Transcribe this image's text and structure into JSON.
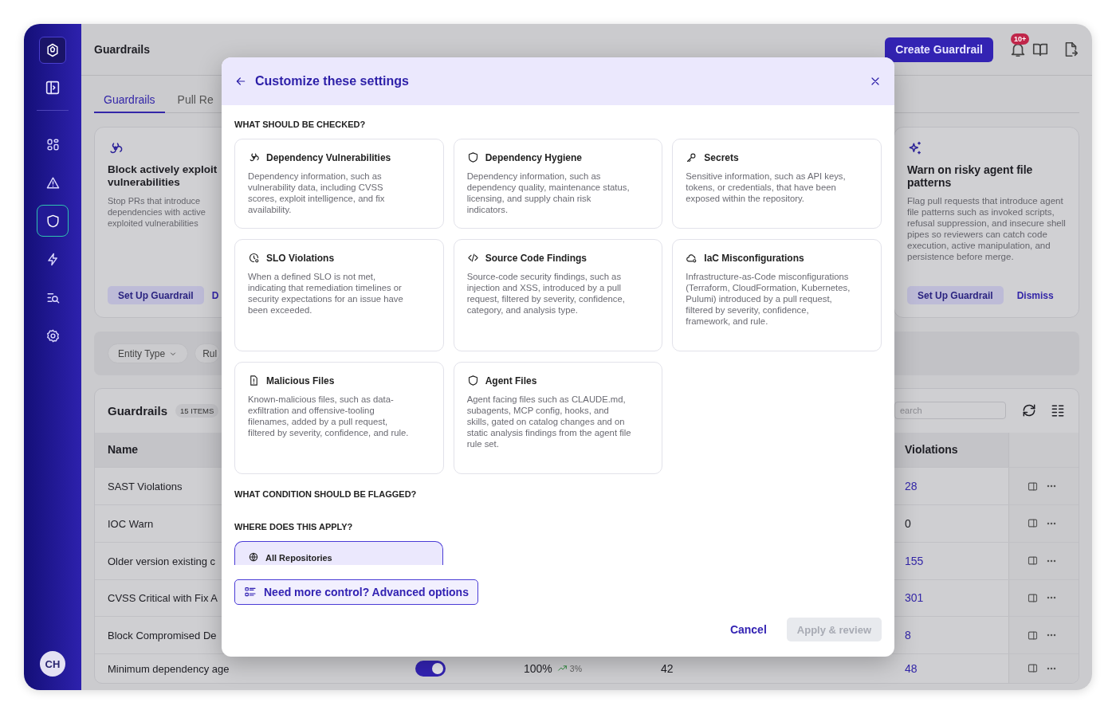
{
  "sidebar": {
    "nav": [
      {
        "selected": false
      },
      {
        "selected": false
      },
      {
        "selected": true
      },
      {
        "selected": false
      },
      {
        "selected": false
      },
      {
        "selected": false
      }
    ],
    "avatar": "CH"
  },
  "header": {
    "title": "Guardrails",
    "create_button": "Create Guardrail",
    "notification_badge": "10+"
  },
  "tabs": [
    {
      "label": "Guardrails",
      "selected": true
    },
    {
      "label": "Pull Re",
      "selected": false
    }
  ],
  "cards": [
    {
      "title": "Block actively exploit\nvulnerabilities",
      "description": "Stop PRs that introduce\ndependencies with active\nexploited vulnerabilities",
      "primary_button": "Set Up Guardrail",
      "secondary_link": "D"
    },
    {
      "title": "Warn on risky agent file patterns",
      "description": "Flag pull requests that introduce agent file patterns such as invoked scripts, refusal suppression, and insecure shell pipes so reviewers can catch code execution, active manipulation, and persistence before merge.",
      "primary_button": "Set Up Guardrail",
      "secondary_link": "Dismiss"
    }
  ],
  "filters": [
    {
      "label": "Entity Type",
      "kind": "dropdown"
    },
    {
      "label": "Rul",
      "kind": "chip"
    }
  ],
  "table": {
    "title": "Guardrails",
    "count": "15 ITEMS",
    "search_placeholder": "earch",
    "columns": [
      "Name",
      "Violations"
    ],
    "rows": [
      {
        "name": "SAST Violations",
        "violations": "28",
        "linked": true
      },
      {
        "name": "IOC Warn",
        "violations": "0",
        "linked": false
      },
      {
        "name": "Older version existing c",
        "violations": "155",
        "linked": true
      },
      {
        "name": "CVSS Critical with Fix A",
        "violations": "301",
        "linked": true
      },
      {
        "name": "Block Compromised De",
        "violations": "8",
        "linked": true
      },
      {
        "name": "Minimum dependency age",
        "violations": "48",
        "linked": true,
        "enabled": true,
        "pass_rate": "100%",
        "trend": "3%",
        "count": "42"
      }
    ]
  },
  "modal": {
    "title": "Customize these settings",
    "checks_heading": "WHAT SHOULD BE CHECKED?",
    "checks": [
      {
        "title": "Dependency Vulnerabilities",
        "description": "Dependency information, such as vulnerability data, including CVSS scores, exploit intelligence, and fix availability.",
        "selected": false
      },
      {
        "title": "Dependency Hygiene",
        "description": "Dependency information, such as dependency quality, maintenance status, licensing, and supply chain risk indicators.",
        "selected": false
      },
      {
        "title": "Secrets",
        "description": "Sensitive information, such as API keys, tokens, or credentials, that have been exposed within the repository.",
        "selected": false
      },
      {
        "title": "SLO Violations",
        "description": "When a defined SLO is not met, indicating that remediation timelines or security expectations for an issue have been exceeded.",
        "selected": false
      },
      {
        "title": "Source Code Findings",
        "description": "Source-code security findings, such as injection and XSS, introduced by a pull request, filtered by severity, confidence, category, and analysis type.",
        "selected": false
      },
      {
        "title": "IaC Misconfigurations",
        "description": "Infrastructure-as-Code misconfigurations (Terraform, CloudFormation, Kubernetes, Pulumi) introduced by a pull request, filtered by severity, confidence, framework, and rule.",
        "selected": false
      },
      {
        "title": "Malicious Files",
        "description": "Known-malicious files, such as data-exfiltration and offensive-tooling filenames, added by a pull request, filtered by severity, confidence, and rule.",
        "selected": false
      },
      {
        "title": "Agent Files",
        "description": "Agent facing files such as CLAUDE.md, subagents, MCP config, hooks, and skills, gated on catalog changes and on static analysis findings from the agent file rule set.",
        "selected": false
      }
    ],
    "condition_heading": "WHAT CONDITION SHOULD BE FLAGGED?",
    "scope_heading": "WHERE DOES THIS APPLY?",
    "scopes": [
      {
        "label": "All Repositories",
        "selected": true
      }
    ],
    "advanced_button": "Need more control? Advanced options",
    "cancel_button": "Cancel",
    "apply_button": {
      "label": "Apply & review",
      "disabled": true
    }
  }
}
